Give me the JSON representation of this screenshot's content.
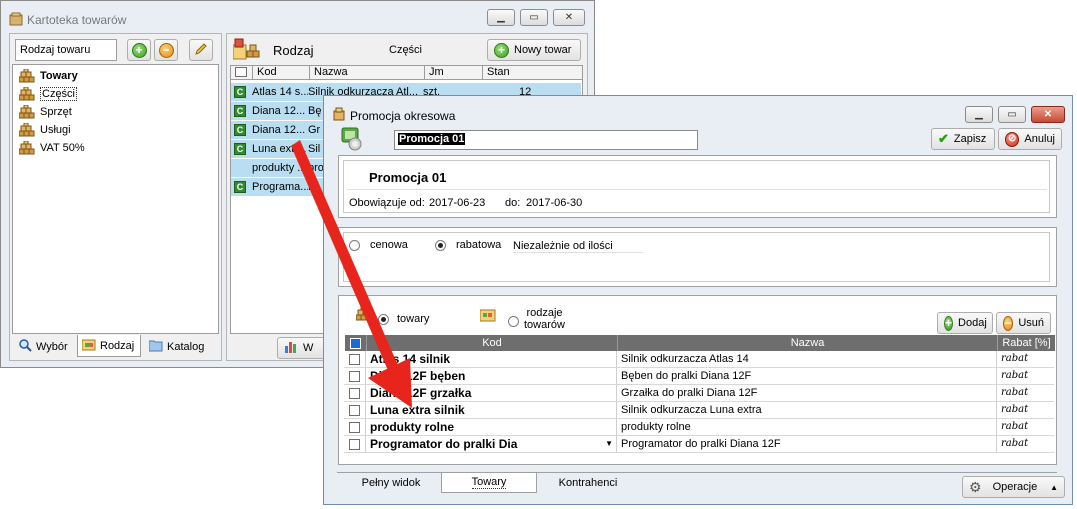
{
  "kartoteka": {
    "title": "Kartoteka towarów",
    "filter_value": "Rodzaj towaru",
    "tree": [
      {
        "label": "Towary",
        "bold": true
      },
      {
        "label": "Części",
        "selected": true
      },
      {
        "label": "Sprzęt"
      },
      {
        "label": "Usługi"
      },
      {
        "label": "VAT 50%"
      }
    ],
    "left_tabs": [
      "Wybór",
      "Rodzaj",
      "Katalog"
    ],
    "section_title": "Rodzaj",
    "section_value": "Części",
    "new_button": "Nowy towar",
    "columns": [
      "Kod",
      "Nazwa",
      "Jm",
      "Stan"
    ],
    "rows": [
      {
        "badge": "C",
        "kod": "Atlas 14 s...",
        "nazwa": "Silnik odkurzacza Atl...",
        "jm": "szt.",
        "stan": "12"
      },
      {
        "badge": "C",
        "kod": "Diana 12...",
        "nazwa": "Bę",
        "jm": "",
        "stan": ""
      },
      {
        "badge": "C",
        "kod": "Diana 12...",
        "nazwa": "Gr",
        "jm": "",
        "stan": ""
      },
      {
        "badge": "C",
        "kod": "Luna extr...",
        "nazwa": "Sil",
        "jm": "",
        "stan": ""
      },
      {
        "badge": "",
        "kod": "produkty ...",
        "nazwa": "pro",
        "jm": "",
        "stan": ""
      },
      {
        "badge": "C",
        "kod": "Programa...",
        "nazwa": "Pr",
        "jm": "",
        "stan": ""
      }
    ],
    "bottom_tab": "W"
  },
  "promocja": {
    "title": "Promocja okresowa",
    "name_value": "Promocja 01",
    "save": "Zapisz",
    "cancel": "Anuluj",
    "header_name": "Promocja 01",
    "valid_from_label": "Obowiązuje od:",
    "valid_from": "2017-06-23",
    "valid_to_label": "do:",
    "valid_to": "2017-06-30",
    "type_cenowa": "cenowa",
    "type_rabatowa": "rabatowa",
    "qty_mode": "Niezależnie od ilości",
    "scope_towary": "towary",
    "scope_rodzaje": "rodzaje\ntowarów",
    "add": "Dodaj",
    "remove": "Usuń",
    "columns": [
      "Kod",
      "Nazwa",
      "Rabat [%]"
    ],
    "rows": [
      {
        "kod": "Atlas 14 silnik",
        "nazwa": "Silnik odkurzacza Atlas 14",
        "rabat": "rabat"
      },
      {
        "kod": "Diana 12F bęben",
        "nazwa": "Bęben do pralki Diana 12F",
        "rabat": "rabat"
      },
      {
        "kod": "Diana 12F grzałka",
        "nazwa": "Grzałka do pralki Diana 12F",
        "rabat": "rabat"
      },
      {
        "kod": "Luna extra silnik",
        "nazwa": "Silnik odkurzacza Luna extra",
        "rabat": "rabat"
      },
      {
        "kod": "produkty rolne",
        "nazwa": "produkty rolne",
        "rabat": "rabat"
      },
      {
        "kod": "Programator do pralki Dia",
        "nazwa": "Programator do pralki Diana 12F",
        "rabat": "rabat"
      }
    ],
    "tabs": [
      "Pełny widok",
      "Towary",
      "Kontrahenci"
    ],
    "active_tab": "Towary",
    "operations": "Operacje"
  },
  "colors": {
    "arrow": "#e8251c",
    "selection": "#b9def2",
    "grid_header": "#6e6e6e"
  }
}
